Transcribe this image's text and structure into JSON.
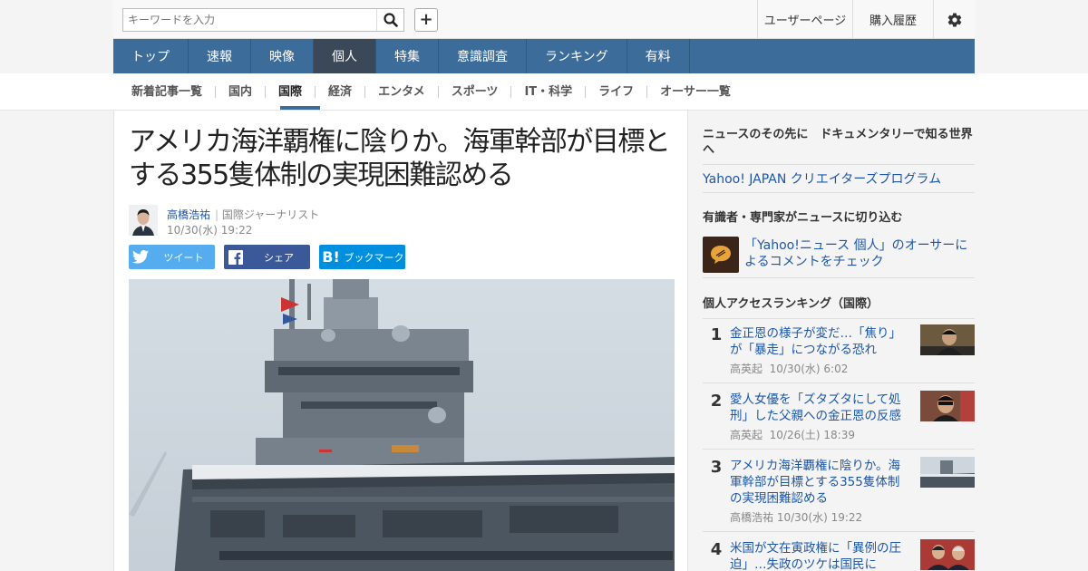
{
  "header": {
    "search_placeholder": "キーワードを入力",
    "search_icon": "search-icon",
    "add_button": "+",
    "user_page": "ユーザーページ",
    "purchase_history": "購入履歴",
    "settings_icon": "gear-icon"
  },
  "main_nav": [
    "トップ",
    "速報",
    "映像",
    "個人",
    "特集",
    "意識調査",
    "ランキング",
    "有料"
  ],
  "main_nav_active": "個人",
  "sub_nav": [
    "新着記事一覧",
    "国内",
    "国際",
    "経済",
    "エンタメ",
    "スポーツ",
    "IT・科学",
    "ライフ",
    "オーサー一覧"
  ],
  "sub_nav_active": "国際",
  "article": {
    "title": "アメリカ海洋覇権に陰りか。海軍幹部が目標とする355隻体制の実現困難認める",
    "author": "高橋浩祐",
    "author_role": "国際ジャーナリスト",
    "date": "10/30(水) 19:22"
  },
  "share": {
    "tweet": "ツイート",
    "facebook": "シェア",
    "hatena": "ブックマーク"
  },
  "sidebar": {
    "doc_heading": "ニュースのその先に　ドキュメンタリーで知る世界へ",
    "creators_link": "Yahoo! JAPAN クリエイターズプログラム",
    "experts_heading": "有識者・専門家がニュースに切り込む",
    "experts_link": "「Yahoo!ニュース 個人」のオーサーによるコメントをチェック",
    "ranking_heading": "個人アクセスランキング（国際）",
    "ranking": [
      {
        "num": "1",
        "title": "金正恩の様子が変だ…「焦り」が「暴走」につながる恐れ",
        "author": "高英起",
        "date": "10/30(水) 6:02"
      },
      {
        "num": "2",
        "title": "愛人女優を「ズタズタにして処刑」した父親への金正恩の反感",
        "author": "高英起",
        "date": "10/26(土) 18:39"
      },
      {
        "num": "3",
        "title": "アメリカ海洋覇権に陰りか。海軍幹部が目標とする355隻体制の実現困難認める",
        "author": "高橋浩祐",
        "date": "10/30(水) 19:22"
      },
      {
        "num": "4",
        "title": "米国が文在寅政権に「異例の圧迫」…失政のツケは国民に",
        "author": "",
        "date": ""
      }
    ]
  },
  "colors": {
    "nav_bg": "#3c6d9a",
    "nav_active": "#3a4858",
    "link": "#1d56a8",
    "twitter": "#55acee",
    "facebook": "#3b5998",
    "hatena": "#008fde"
  }
}
